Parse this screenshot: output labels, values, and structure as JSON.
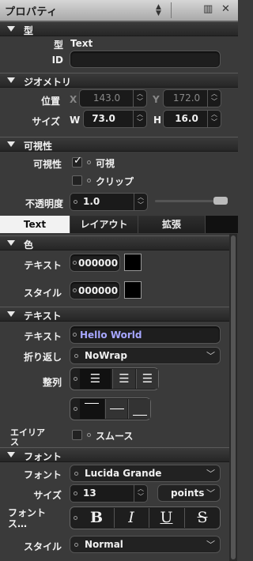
{
  "header": {
    "title": "プロパティ"
  },
  "sections": {
    "type": "型",
    "geometry": "ジオメトリ",
    "visibility": "可視性",
    "color": "色",
    "text": "テキスト",
    "font": "フォント"
  },
  "type": {
    "type_label": "型",
    "type_value": "Text",
    "id_label": "ID",
    "id_value": ""
  },
  "geometry": {
    "position_label": "位置",
    "x_label": "X",
    "x_value": "143.0",
    "y_label": "Y",
    "y_value": "172.0",
    "size_label": "サイズ",
    "w_label": "W",
    "w_value": "73.0",
    "h_label": "H",
    "h_value": "16.0"
  },
  "visibility": {
    "label": "可視性",
    "visible_label": "可視",
    "clip_label": "クリップ",
    "opacity_label": "不透明度",
    "opacity_value": "1.0",
    "visible_checked": true,
    "clip_checked": false
  },
  "tabs": [
    {
      "label": "Text",
      "active": true
    },
    {
      "label": "レイアウト",
      "active": false
    },
    {
      "label": "拡張",
      "active": false
    }
  ],
  "color": {
    "text_label": "テキスト",
    "text_value": "000000",
    "style_label": "スタイル",
    "style_value": "000000"
  },
  "text": {
    "text_label": "テキスト",
    "text_value": "Hello World",
    "wrap_label": "折り返し",
    "wrap_value": "NoWrap",
    "align_label": "整列"
  },
  "antialias": {
    "label": "エイリア\nス",
    "smooth_label": "スムース"
  },
  "font": {
    "font_label": "フォント",
    "font_value": "Lucida Grande",
    "size_label": "サイズ",
    "size_value": "13",
    "unit_value": "points",
    "style_label_1": "フォント",
    "style_label_2": "ス…",
    "bold": "B",
    "italic": "I",
    "underline": "U",
    "strike": "S",
    "style2_label": "スタイル",
    "style2_value": "Normal"
  }
}
